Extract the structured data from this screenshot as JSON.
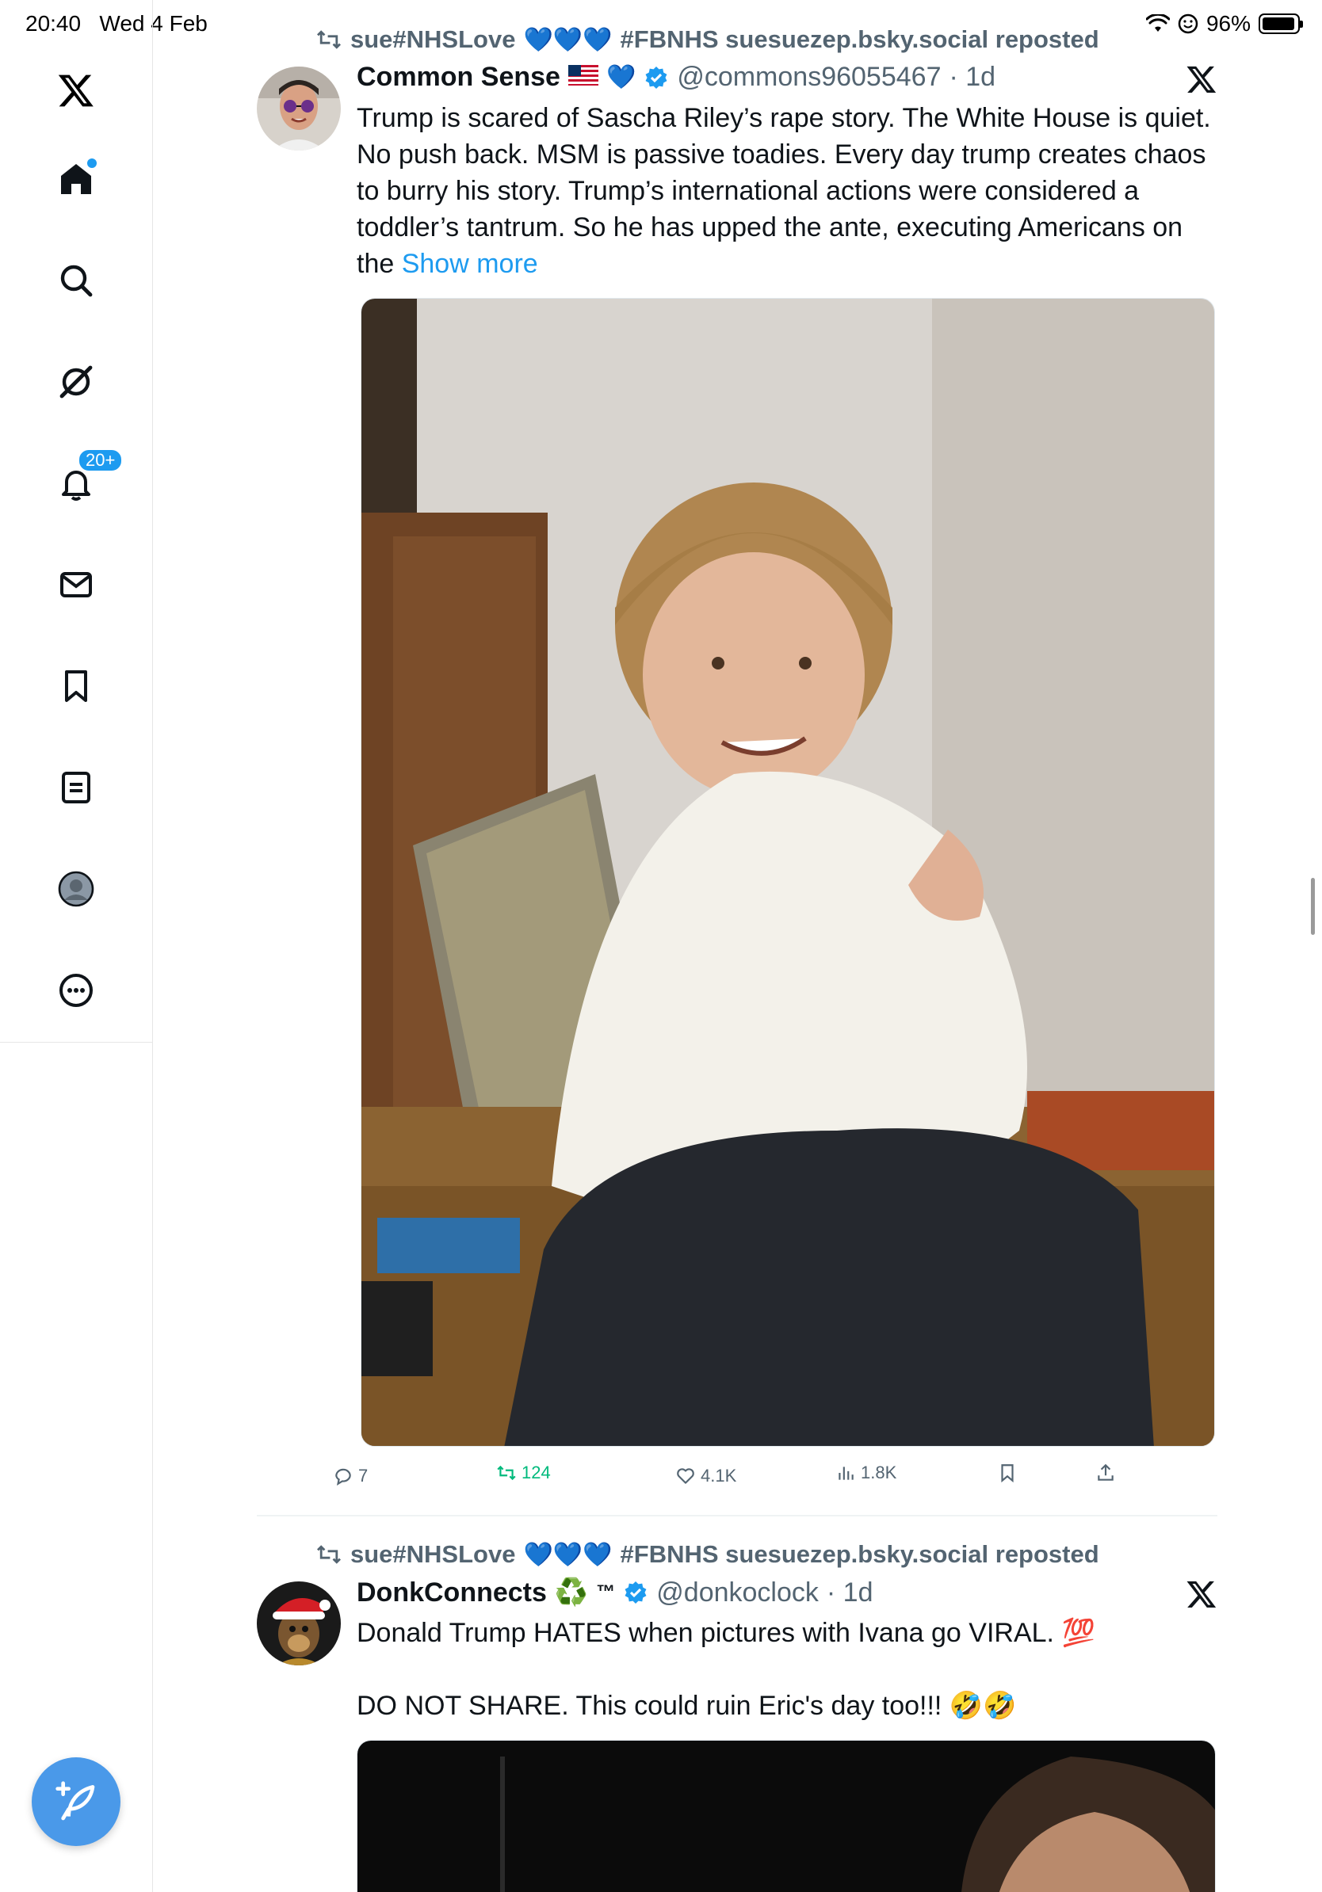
{
  "status_bar": {
    "time": "20:40",
    "date": "Wed 4 Feb",
    "battery": "96%",
    "battery_level": 0.96
  },
  "sidebar": {
    "items": [
      {
        "name": "x-logo-icon"
      },
      {
        "name": "home-icon",
        "has_dot": true
      },
      {
        "name": "search-icon"
      },
      {
        "name": "grok-icon"
      },
      {
        "name": "notifications-icon",
        "badge": "20+"
      },
      {
        "name": "messages-icon"
      },
      {
        "name": "bookmarks-icon"
      },
      {
        "name": "lists-icon"
      },
      {
        "name": "profile-icon"
      },
      {
        "name": "more-icon"
      }
    ],
    "compose": "compose-icon"
  },
  "tweets": [
    {
      "repost_user": "sue#NHSLove",
      "repost_suffix": "#FBNHS suesuezep.bsky.social reposted",
      "name": "Common Sense",
      "handle": "@commons96055467",
      "time": "· 1d",
      "text": "Trump is scared of Sascha Riley’s rape story. The White House is quiet. No push back. MSM is passive toadies. Every day trump creates chaos to burry his story. Trump’s international actions were considered a toddler’s tantrum. So he has upped the ante, executing Americans on the",
      "show_more": "Show more",
      "replies": "7",
      "reposts": "124",
      "likes": "4.1K",
      "views": "1.8K"
    },
    {
      "repost_user": "sue#NHSLove",
      "repost_suffix": "#FBNHS suesuezep.bsky.social reposted",
      "name": "DonkConnects",
      "name_suffix": "™",
      "handle": "@donkoclock",
      "time": "· 1d",
      "text_line1": "Donald Trump HATES when pictures with Ivana go VIRAL. 💯",
      "text_line2": "DO NOT SHARE. This could ruin Eric's day too!!! 🤣🤣"
    }
  ],
  "colors": {
    "accent": "#1d9bf0",
    "repost_green": "#00ba7c",
    "muted": "#536471",
    "compose_bg": "#4a99e9"
  }
}
